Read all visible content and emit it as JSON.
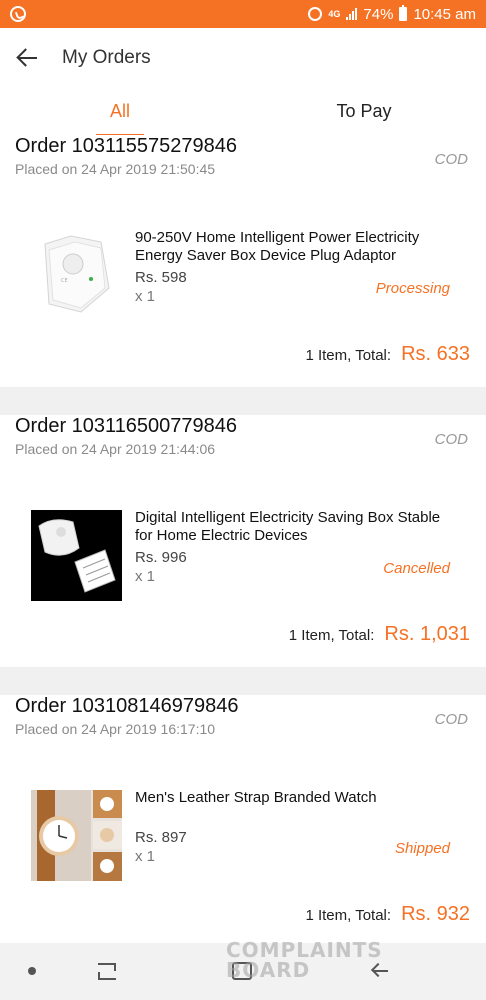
{
  "status_bar": {
    "network": "4G",
    "battery": "74%",
    "time": "10:45 am",
    "icons": [
      "whatsapp-icon",
      "alarm-icon",
      "signal-icon",
      "battery-icon"
    ]
  },
  "header": {
    "title": "My Orders",
    "back_icon": "arrow-left-icon"
  },
  "tabs": [
    {
      "label": "All",
      "selected": true
    },
    {
      "label": "To Pay",
      "selected": false
    }
  ],
  "orders": [
    {
      "order_no": "Order 103115575279846",
      "placed": "Placed on 24 Apr 2019  21:50:45",
      "payment": "COD",
      "item_name": "90-250V Home Intelligent Power Electricity Energy Saver Box Device Plug Adaptor",
      "price": "Rs. 598",
      "qty": "x 1",
      "status": "Processing",
      "total_label": "1 Item, Total:",
      "total": "Rs. 633"
    },
    {
      "order_no": "Order 103116500779846",
      "placed": "Placed on 24 Apr 2019  21:44:06",
      "payment": "COD",
      "item_name": "Digital Intelligent Electricity Saving Box Stable for Home Electric Devices",
      "price": "Rs. 996",
      "qty": "x 1",
      "status": "Cancelled",
      "total_label": "1 Item, Total:",
      "total": "Rs. 1,031"
    },
    {
      "order_no": "Order 103108146979846",
      "placed": "Placed on 24 Apr 2019  16:17:10",
      "payment": "COD",
      "item_name": "Men's Leather Strap Branded Watch",
      "price": "Rs. 897",
      "qty": "x 1",
      "status": "Shipped",
      "total_label": "1 Item, Total:",
      "total": "Rs. 932"
    }
  ],
  "watermark": {
    "line1": "COMPLAINTS",
    "line2": "BOARD"
  },
  "colors": {
    "accent": "#f57224",
    "background": "#f0f0f0"
  }
}
